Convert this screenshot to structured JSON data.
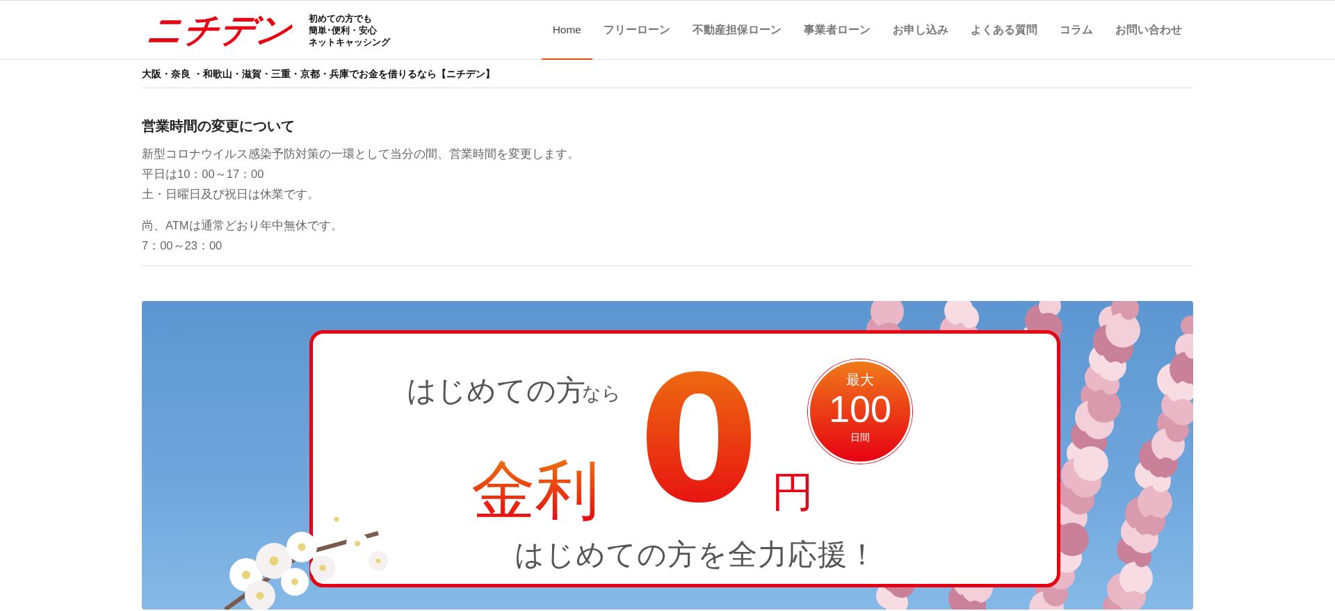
{
  "header": {
    "logo": "ニチデン",
    "tagline": [
      "初めての方でも",
      "簡単･便利・安心",
      "ネットキャッシング"
    ]
  },
  "nav": [
    {
      "label": "Home",
      "selected": true
    },
    {
      "label": "フリーローン",
      "selected": false
    },
    {
      "label": "不動産担保ローン",
      "selected": false
    },
    {
      "label": "事業者ローン",
      "selected": false
    },
    {
      "label": "お申し込み",
      "selected": false
    },
    {
      "label": "よくある質問",
      "selected": false
    },
    {
      "label": "コラム",
      "selected": false
    },
    {
      "label": "お問い合わせ",
      "selected": false
    }
  ],
  "breadcrumb": "大阪・奈良 ・和歌山・滋賀・三重・京都・兵庫でお金を借りるなら【ニチデン】",
  "notice": {
    "title": "営業時間の変更について",
    "paragraphs": [
      [
        "新型コロナウイルス感染予防対策の一環として当分の間、営業時間を変更します。",
        "平日は10：00～17：00",
        "土・日曜日及び祝日は休業です。"
      ],
      [
        "尚、ATMは通常どおり年中無休です。",
        "7：00～23：00"
      ]
    ]
  },
  "banner": {
    "lead": "はじめての方",
    "lead_suffix": "なら",
    "rate_label": "金利",
    "rate_value": "0",
    "unit": "円",
    "badge": {
      "top": "最大",
      "number": "100",
      "bottom": "日間"
    },
    "tagline": "はじめての方を全力応援！"
  }
}
